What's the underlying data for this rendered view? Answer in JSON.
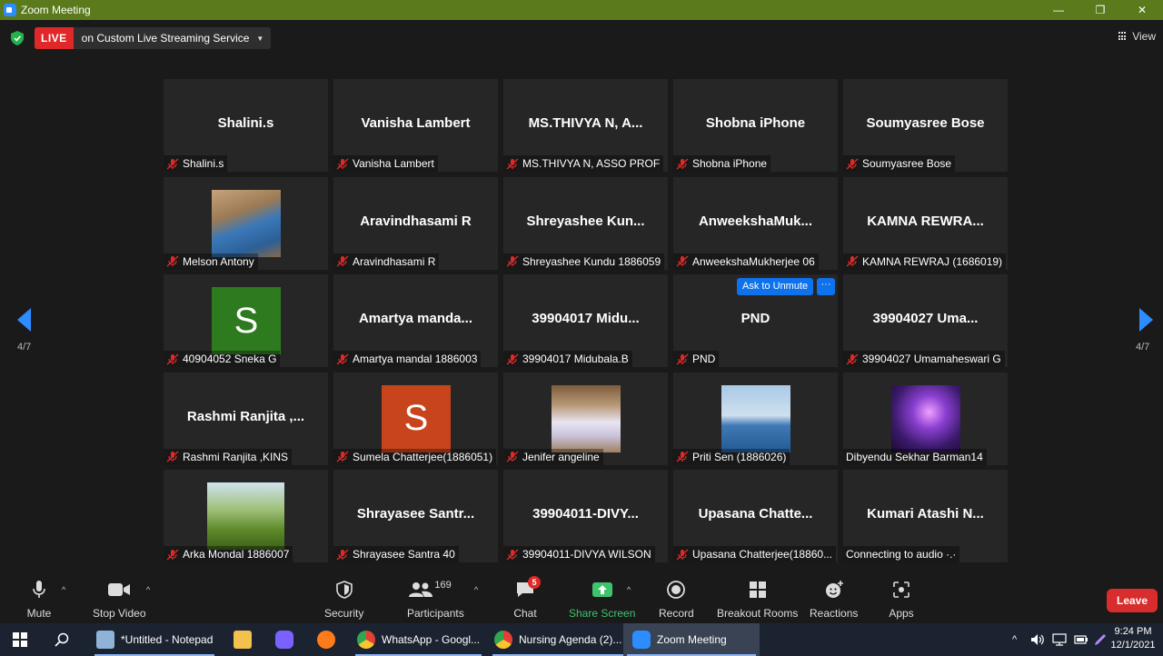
{
  "window": {
    "title": "Zoom Meeting"
  },
  "topbar": {
    "live_badge": "LIVE",
    "live_service": "on Custom Live Streaming Service",
    "view_label": "View"
  },
  "pagination": {
    "left_label": "4/7",
    "right_label": "4/7"
  },
  "tiles": [
    {
      "center_name": "Shalini.s",
      "caption": "Shalini.s",
      "muted": true
    },
    {
      "center_name": "Vanisha Lambert",
      "caption": "Vanisha Lambert",
      "muted": true
    },
    {
      "center_name": "MS.THIVYA N, A...",
      "caption": "MS.THIVYA N, ASSO PROF",
      "muted": true
    },
    {
      "center_name": "Shobna iPhone",
      "caption": "Shobna iPhone",
      "muted": true
    },
    {
      "center_name": "Soumyasree Bose",
      "caption": "Soumyasree Bose",
      "muted": true
    },
    {
      "center_name": "",
      "caption": "Melson Antony",
      "muted": true,
      "avatar": "photo-man-blue-shirt"
    },
    {
      "center_name": "Aravindhasami R",
      "caption": "Aravindhasami R",
      "muted": true
    },
    {
      "center_name": "Shreyashee  Kun...",
      "caption": "Shreyashee Kundu 1886059",
      "muted": true
    },
    {
      "center_name": "AnweekshaMuk...",
      "caption": "AnweekshaMukherjee 06",
      "muted": true
    },
    {
      "center_name": "KAMNA  REWRA...",
      "caption": "KAMNA REWRAJ (1686019)",
      "muted": true
    },
    {
      "center_name": "",
      "caption": "40904052 Sneka G",
      "muted": true,
      "avatar_letter": "S",
      "avatar_color": "#2e7a1f"
    },
    {
      "center_name": "Amartya  manda...",
      "caption": "Amartya mandal 1886003",
      "muted": true
    },
    {
      "center_name": "39904017  Midu...",
      "caption": "39904017 Midubala.B",
      "muted": true
    },
    {
      "center_name": "PND",
      "caption": "PND",
      "muted": true,
      "ask_unmute": "Ask to Unmute",
      "more": "···"
    },
    {
      "center_name": "39904027  Uma...",
      "caption": "39904027 Umamaheswari G",
      "muted": true
    },
    {
      "center_name": "Rashmi  Ranjita  ,...",
      "caption": "Rashmi Ranjita ,KINS",
      "muted": true
    },
    {
      "center_name": "",
      "caption": "Sumela Chatterjee(1886051)",
      "muted": true,
      "avatar_letter": "S",
      "avatar_color": "#c8441c"
    },
    {
      "center_name": "",
      "caption": "Jenifer angeline",
      "muted": true,
      "avatar": "photo-woman-white-dress"
    },
    {
      "center_name": "",
      "caption": "Priti Sen (1886026)",
      "muted": true,
      "avatar": "photo-seabird"
    },
    {
      "center_name": "",
      "caption": "Dibyendu Sekhar Barman14",
      "muted": false,
      "avatar": "photo-purple-lights"
    },
    {
      "center_name": "",
      "caption": "Arka Mondal 1886007",
      "muted": true,
      "avatar": "photo-grass-field"
    },
    {
      "center_name": "Shrayasee  Santr...",
      "caption": "Shrayasee Santra 40",
      "muted": true
    },
    {
      "center_name": "39904011-DIVY...",
      "caption": "39904011-DIVYA WILSON",
      "muted": true
    },
    {
      "center_name": "Upasana  Chatte...",
      "caption": "Upasana Chatterjee(18860...",
      "muted": true
    },
    {
      "center_name": "Kumari Atashi  N...",
      "caption": "Connecting to audio ·.·",
      "muted": false
    }
  ],
  "toolbar": {
    "mute": "Mute",
    "stop_video": "Stop Video",
    "security": "Security",
    "participants": "Participants",
    "participant_count": "169",
    "chat": "Chat",
    "chat_badge": "5",
    "share_screen": "Share Screen",
    "record": "Record",
    "breakout_rooms": "Breakout Rooms",
    "reactions": "Reactions",
    "apps": "Apps",
    "leave": "Leave"
  },
  "taskbar": {
    "items": [
      {
        "label": "*Untitled - Notepad",
        "icon": "notepad-icon"
      },
      {
        "label": "WhatsApp - Googl...",
        "icon": "chrome-icon"
      },
      {
        "label": "Nursing Agenda (2)...",
        "icon": "chrome-icon"
      },
      {
        "label": "Zoom Meeting",
        "icon": "zoom-icon"
      }
    ],
    "time": "9:24 PM",
    "date": "12/1/2021"
  },
  "colors": {
    "titlebar": "#5a7a1c",
    "live": "#e02828",
    "accent": "#2d8cff",
    "share_green": "#3ec46d",
    "leave": "#d92c2c"
  }
}
